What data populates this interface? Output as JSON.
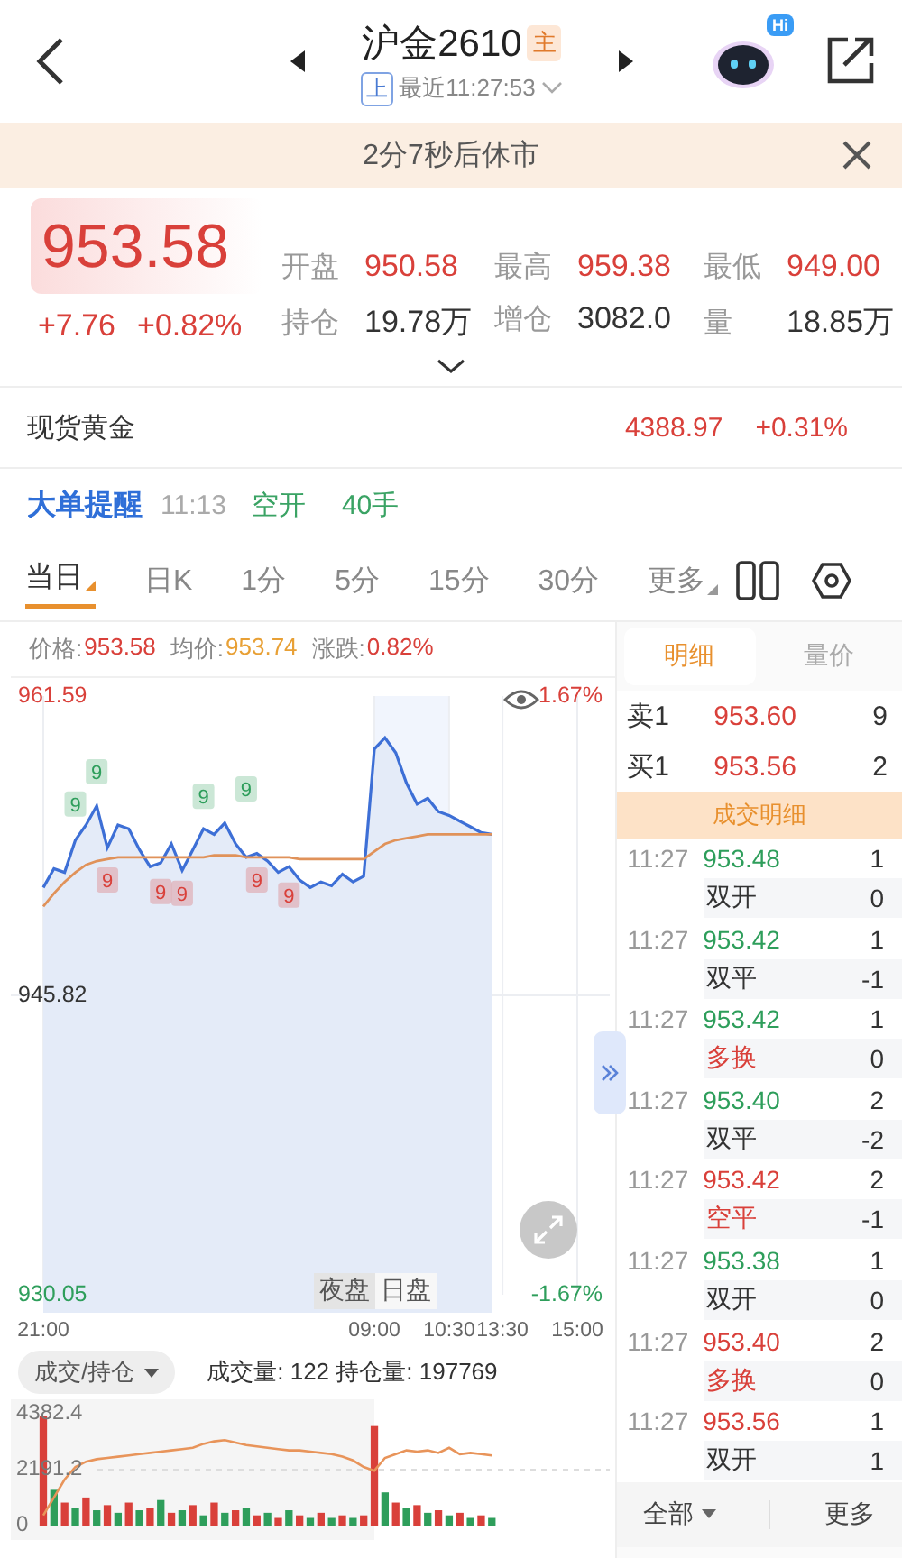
{
  "header": {
    "title": "沪金2610",
    "badge": "主",
    "exchange": "上",
    "updated": "最近11:27:53",
    "assistant_badge": "Hi"
  },
  "notice": {
    "text": "2分7秒后休市"
  },
  "quote": {
    "price": "953.58",
    "change": "+7.76",
    "change_pct": "+0.82%",
    "stats": [
      {
        "label": "开盘",
        "value": "950.58",
        "color": "#d9403a"
      },
      {
        "label": "最高",
        "value": "959.38",
        "color": "#d9403a"
      },
      {
        "label": "最低",
        "value": "949.00",
        "color": "#d9403a"
      },
      {
        "label": "持仓",
        "value": "19.78万",
        "color": "#333333"
      },
      {
        "label": "增仓",
        "value": "3082.0",
        "color": "#333333"
      },
      {
        "label": "量",
        "value": "18.85万",
        "color": "#333333"
      }
    ]
  },
  "spot": {
    "name": "现货黄金",
    "price": "4388.97",
    "change": "+0.31%"
  },
  "alert": {
    "title": "大单提醒",
    "time": "11:13",
    "action": "空开",
    "size": "40手"
  },
  "period_tabs": [
    {
      "label": "当日",
      "selected": true,
      "menu": true
    },
    {
      "label": "日K",
      "selected": false,
      "menu": false
    },
    {
      "label": "1分",
      "selected": false,
      "menu": false
    },
    {
      "label": "5分",
      "selected": false,
      "menu": false
    },
    {
      "label": "15分",
      "selected": false,
      "menu": false
    },
    {
      "label": "30分",
      "selected": false,
      "menu": false
    },
    {
      "label": "更多",
      "selected": false,
      "menu": true
    }
  ],
  "chart_info": [
    {
      "label": "价格:",
      "value": "953.58",
      "color": "#d9403a"
    },
    {
      "label": "均价:",
      "value": "953.74",
      "color": "#e8a035"
    },
    {
      "label": "涨跌:",
      "value": "0.82%",
      "color": "#d9403a"
    }
  ],
  "price_chart": {
    "right_labels": [
      "1.67%",
      "-1.67%"
    ],
    "sessions": [
      {
        "label": "夜盘",
        "selected": true
      },
      {
        "label": "日盘",
        "selected": false
      }
    ],
    "signals": [
      {
        "text": "9",
        "kind": "buy"
      },
      {
        "text": "9",
        "kind": "buy"
      },
      {
        "text": "9",
        "kind": "sell"
      },
      {
        "text": "9",
        "kind": "sell"
      },
      {
        "text": "9",
        "kind": "sell"
      },
      {
        "text": "9",
        "kind": "buy"
      },
      {
        "text": "9",
        "kind": "buy"
      },
      {
        "text": "9",
        "kind": "sell"
      },
      {
        "text": "9",
        "kind": "sell"
      }
    ],
    "chart_data": {
      "type": "line",
      "categories": [
        "21:00",
        null,
        null,
        null,
        null,
        null,
        null,
        null,
        null,
        null,
        null,
        null,
        null,
        null,
        null,
        null,
        null,
        null,
        null,
        null,
        null,
        null,
        null,
        null,
        null,
        null,
        null,
        null,
        null,
        null,
        null,
        "09:00",
        null,
        null,
        null,
        null,
        null,
        null,
        "10:30",
        null,
        null,
        null,
        null,
        "13:30",
        null,
        null,
        null,
        null,
        null,
        null,
        "15:00"
      ],
      "series": [
        {
          "color": "#3d6fd6",
          "values": [
            951.5,
            952.5,
            952.3,
            954.0,
            954.8,
            955.8,
            953.6,
            954.8,
            954.6,
            953.5,
            952.6,
            952.8,
            953.8,
            952.4,
            953.5,
            954.6,
            954.3,
            954.9,
            953.8,
            953.1,
            953.3,
            952.9,
            952.3,
            952.6,
            951.9,
            951.5,
            951.8,
            951.6,
            952.2,
            951.8,
            952.1,
            958.8,
            959.4,
            958.6,
            957.0,
            955.9,
            956.2,
            955.5,
            955.3,
            955.0,
            954.7,
            954.4,
            954.3,
            null,
            null,
            null,
            null,
            null,
            null,
            null,
            null
          ]
        },
        {
          "color": "#e0925a",
          "values": [
            950.5,
            951.2,
            951.8,
            952.3,
            952.7,
            952.9,
            953.0,
            953.1,
            953.1,
            953.1,
            953.1,
            953.1,
            953.1,
            953.1,
            953.1,
            953.1,
            953.2,
            953.2,
            953.2,
            953.1,
            953.1,
            953.1,
            953.1,
            953.1,
            953.0,
            953.0,
            953.0,
            953.0,
            953.0,
            953.0,
            953.0,
            953.4,
            953.8,
            954.0,
            954.1,
            954.2,
            954.3,
            954.3,
            954.3,
            954.3,
            954.3,
            954.3,
            954.3,
            null,
            null,
            null,
            null,
            null,
            null,
            null,
            null
          ]
        }
      ],
      "ylim": [
        930.05,
        961.59
      ],
      "grid": true,
      "yticks": [
        {
          "value": 961.59,
          "label": "961.59"
        },
        {
          "value": 945.82,
          "label": "945.82"
        },
        {
          "value": 930.05,
          "label": "930.05"
        }
      ]
    }
  },
  "volume": {
    "selector": "成交/持仓",
    "summary": "成交量: 122 持仓量: 197769",
    "chart_data": {
      "type": "bar",
      "categories": [
        null,
        null,
        null,
        null,
        null,
        null,
        null,
        null,
        null,
        null,
        null,
        null,
        null,
        null,
        null,
        null,
        null,
        null,
        null,
        null,
        null,
        null,
        null,
        null,
        null,
        null,
        null,
        null,
        null,
        null,
        null,
        null,
        null,
        null,
        null,
        null,
        null,
        null,
        null,
        null,
        null,
        null,
        null,
        null,
        null,
        null,
        null,
        null,
        null,
        null,
        null
      ],
      "series": [
        {
          "values": [
            4300,
            1400,
            900,
            700,
            1100,
            600,
            800,
            500,
            900,
            600,
            700,
            1000,
            500,
            600,
            800,
            400,
            900,
            500,
            600,
            700,
            400,
            500,
            300,
            600,
            400,
            300,
            500,
            300,
            400,
            300,
            400,
            3900,
            1300,
            900,
            700,
            800,
            500,
            600,
            400,
            500,
            300,
            400,
            300,
            null,
            null,
            null,
            null,
            null,
            null,
            null,
            null
          ],
          "colors": [
            "#d9403a",
            "#2e9e5b",
            "#d9403a",
            "#2e9e5b",
            "#d9403a",
            "#2e9e5b",
            "#d9403a",
            "#2e9e5b",
            "#d9403a",
            "#2e9e5b",
            "#d9403a",
            "#2e9e5b",
            "#d9403a",
            "#2e9e5b",
            "#d9403a",
            "#2e9e5b",
            "#d9403a",
            "#2e9e5b",
            "#d9403a",
            "#2e9e5b",
            "#d9403a",
            "#2e9e5b",
            "#d9403a",
            "#2e9e5b",
            "#d9403a",
            "#2e9e5b",
            "#d9403a",
            "#2e9e5b",
            "#d9403a",
            "#2e9e5b",
            "#d9403a",
            "#d9403a",
            "#2e9e5b",
            "#d9403a",
            "#2e9e5b",
            "#d9403a",
            "#2e9e5b",
            "#d9403a",
            "#2e9e5b",
            "#d9403a",
            "#2e9e5b",
            "#d9403a",
            "#2e9e5b",
            null,
            null,
            null,
            null,
            null,
            null,
            null,
            null
          ]
        },
        {
          "type": "line",
          "color": "#e8945a",
          "values": [
            400,
            1100,
            1800,
            2300,
            2500,
            2600,
            2650,
            2700,
            2750,
            2800,
            2850,
            2900,
            2950,
            3000,
            3050,
            3200,
            3300,
            3350,
            3250,
            3150,
            3100,
            3050,
            3000,
            2950,
            2950,
            2900,
            2850,
            2800,
            2700,
            2550,
            2300,
            2150,
            2650,
            2800,
            2950,
            2900,
            2950,
            2850,
            3050,
            2800,
            2850,
            2800,
            2750,
            null,
            null,
            null,
            null,
            null,
            null,
            null,
            null
          ]
        }
      ],
      "ylim": [
        0,
        4382.4
      ],
      "yticks": [
        {
          "value": 4382.4,
          "label": "4382.4"
        },
        {
          "value": 2191.2,
          "label": "2191.2"
        },
        {
          "value": 0,
          "label": "0"
        }
      ]
    }
  },
  "detail_tabs": [
    {
      "label": "明细",
      "selected": true
    },
    {
      "label": "量价",
      "selected": false
    }
  ],
  "order_book": [
    {
      "side": "卖1",
      "price": "953.60",
      "qty": "9"
    },
    {
      "side": "买1",
      "price": "953.56",
      "qty": "2"
    }
  ],
  "trades_header": "成交明细",
  "trades": [
    {
      "time": "11:27",
      "price": "953.48",
      "color": "#2e9e5b",
      "qty": "1",
      "nature": {
        "text": "双开",
        "color": "#333333"
      },
      "change": "0"
    },
    {
      "time": "11:27",
      "price": "953.42",
      "color": "#2e9e5b",
      "qty": "1",
      "nature": {
        "text": "双平",
        "color": "#333333"
      },
      "change": "-1"
    },
    {
      "time": "11:27",
      "price": "953.42",
      "color": "#2e9e5b",
      "qty": "1",
      "nature": {
        "text": "多换",
        "color": "#d9403a"
      },
      "change": "0"
    },
    {
      "time": "11:27",
      "price": "953.40",
      "color": "#2e9e5b",
      "qty": "2",
      "nature": {
        "text": "双平",
        "color": "#333333"
      },
      "change": "-2"
    },
    {
      "time": "11:27",
      "price": "953.42",
      "color": "#d9403a",
      "qty": "2",
      "nature": {
        "text": "空平",
        "color": "#d9403a"
      },
      "change": "-1"
    },
    {
      "time": "11:27",
      "price": "953.38",
      "color": "#2e9e5b",
      "qty": "1",
      "nature": {
        "text": "双开",
        "color": "#333333"
      },
      "change": "0"
    },
    {
      "time": "11:27",
      "price": "953.40",
      "color": "#d9403a",
      "qty": "2",
      "nature": {
        "text": "多换",
        "color": "#d9403a"
      },
      "change": "0"
    },
    {
      "time": "11:27",
      "price": "953.56",
      "color": "#d9403a",
      "qty": "1",
      "nature": {
        "text": "双开",
        "color": "#333333"
      },
      "change": "1"
    }
  ],
  "footer": {
    "filter": "全部",
    "more": "更多"
  }
}
